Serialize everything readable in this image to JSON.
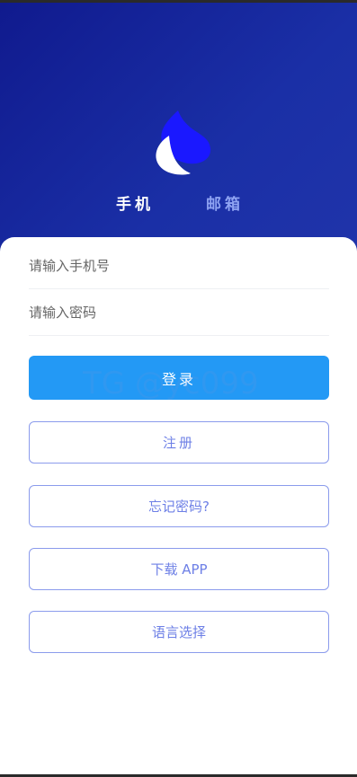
{
  "tabs": {
    "phone": "手机",
    "email": "邮箱"
  },
  "form": {
    "phone_placeholder": "请输入手机号",
    "password_placeholder": "请输入密码"
  },
  "buttons": {
    "login": "登录",
    "register": "注册",
    "forgot": "忘记密码?",
    "download": "下载 APP",
    "language": "语言选择"
  },
  "watermark": "TG @yc099",
  "colors": {
    "hero_bg": "#1a2fa6",
    "primary": "#2399f5",
    "outline": "#8b9bec",
    "logo_blue": "#1a18ff"
  }
}
